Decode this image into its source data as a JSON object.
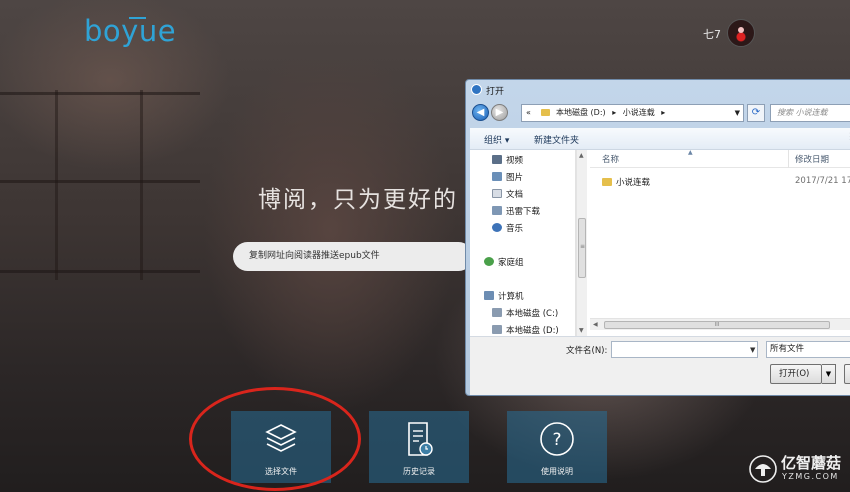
{
  "header": {
    "logo": "boyue",
    "username": "七7"
  },
  "hero": {
    "slogan": "博阅，只为更好的",
    "url_input_placeholder": "复制网址向阅读器推送epub文件"
  },
  "actions": [
    {
      "label": "选择文件",
      "icon": "layers-icon"
    },
    {
      "label": "历史记录",
      "icon": "history-document-icon"
    },
    {
      "label": "使用说明",
      "icon": "help-question-icon"
    }
  ],
  "watermark": {
    "cn": "亿智蘑菇",
    "en": "YZMG.COM"
  },
  "dialog": {
    "title": "打开",
    "address": {
      "prefix": "«",
      "path": [
        "本地磁盘 (D:)",
        "小说连载"
      ],
      "separator": "▸"
    },
    "search_placeholder": "搜索 小说连载",
    "toolbar": {
      "organize": "组织 ▾",
      "new_folder": "新建文件夹"
    },
    "nav_items": [
      {
        "label": "视频",
        "icon": "video-library-icon"
      },
      {
        "label": "图片",
        "icon": "pictures-library-icon"
      },
      {
        "label": "文档",
        "icon": "documents-library-icon"
      },
      {
        "label": "迅雷下载",
        "icon": "download-library-icon"
      },
      {
        "label": "音乐",
        "icon": "music-library-icon"
      },
      {
        "label": "家庭组",
        "icon": "homegroup-icon"
      },
      {
        "label": "计算机",
        "icon": "computer-icon"
      },
      {
        "label": "本地磁盘 (C:)",
        "icon": "drive-icon"
      },
      {
        "label": "本地磁盘 (D:)",
        "icon": "drive-icon"
      }
    ],
    "columns": {
      "name": "名称",
      "date": "修改日期"
    },
    "files": [
      {
        "name": "小说连载",
        "date": "2017/7/21 17:"
      }
    ],
    "filename_label": "文件名(N):",
    "filename_value": "",
    "filter": "所有文件",
    "open_button": "打开(O)",
    "scroll_grip": "III",
    "side_grip": "≡"
  }
}
